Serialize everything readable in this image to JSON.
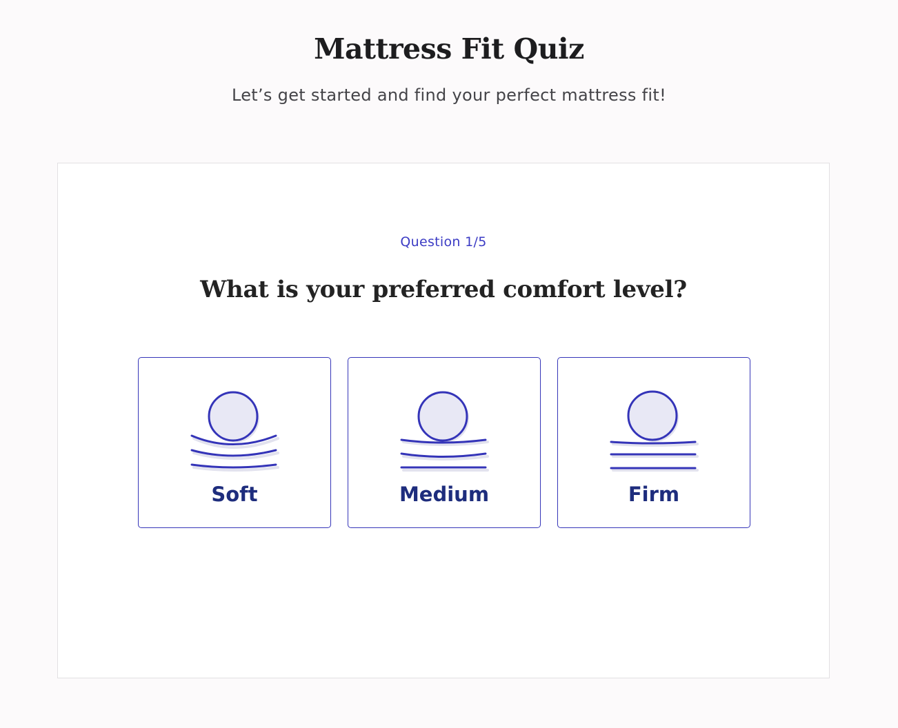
{
  "header": {
    "title": "Mattress Fit Quiz",
    "subtitle": "Let’s get started and find your perfect mattress fit!"
  },
  "quiz": {
    "counter": "Question 1/5",
    "question": "What is your preferred comfort level?",
    "options": [
      {
        "label": "Soft",
        "icon": "soft-mattress-icon"
      },
      {
        "label": "Medium",
        "icon": "medium-mattress-icon"
      },
      {
        "label": "Firm",
        "icon": "firm-mattress-icon"
      }
    ]
  },
  "colors": {
    "accent": "#3434b8",
    "label": "#1e2d7d",
    "icon_fill": "#e8e8f5",
    "icon_shadow": "#e2e2ee",
    "page_background": "#fcfafb",
    "card_background": "#ffffff"
  }
}
